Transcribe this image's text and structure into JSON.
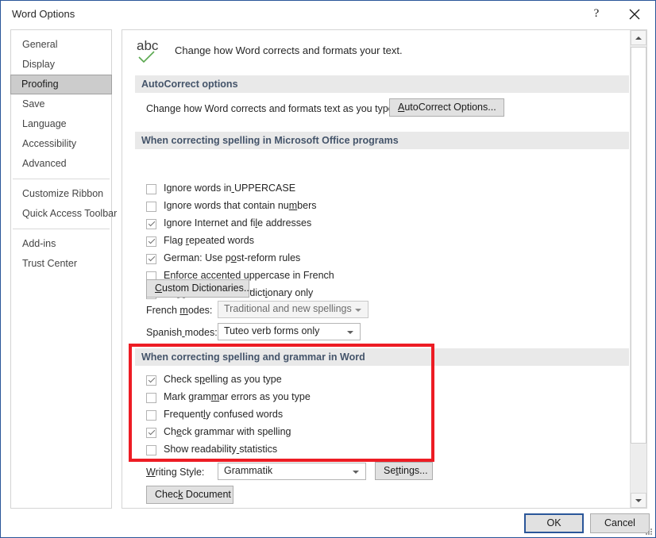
{
  "window": {
    "title": "Word Options",
    "help_glyph": "?",
    "close_icon": "close-icon"
  },
  "sidebar": {
    "items": [
      {
        "label": "General",
        "selected": false
      },
      {
        "label": "Display",
        "selected": false
      },
      {
        "label": "Proofing",
        "selected": true
      },
      {
        "label": "Save",
        "selected": false
      },
      {
        "label": "Language",
        "selected": false
      },
      {
        "label": "Accessibility",
        "selected": false
      },
      {
        "label": "Advanced",
        "selected": false
      },
      {
        "label": "Customize Ribbon",
        "selected": false
      },
      {
        "label": "Quick Access Toolbar",
        "selected": false
      },
      {
        "label": "Add-ins",
        "selected": false
      },
      {
        "label": "Trust Center",
        "selected": false
      }
    ]
  },
  "content": {
    "intro": {
      "icon": "abc-spellcheck-icon",
      "text": "Change how Word corrects and formats your text."
    },
    "autocorrect": {
      "header": "AutoCorrect options",
      "description": "Change how Word corrects and formats text as you type:",
      "button_label": "AutoCorrect Options...",
      "button_accesskey": "A"
    },
    "office_spelling": {
      "header": "When correcting spelling in Microsoft Office programs",
      "checkboxes": [
        {
          "label": "Ignore words in UPPERCASE",
          "checked": false,
          "accesskey": "U",
          "ak_index": 15
        },
        {
          "label": "Ignore words that contain numbers",
          "checked": false,
          "accesskey": "b",
          "ak_index": 28
        },
        {
          "label": "Ignore Internet and file addresses",
          "checked": true,
          "accesskey": "f",
          "ak_index": 22
        },
        {
          "label": "Flag repeated words",
          "checked": true,
          "accesskey": "r",
          "ak_index": 5
        },
        {
          "label": "German: Use post-reform rules",
          "checked": true,
          "accesskey": "o",
          "ak_index": 13
        },
        {
          "label": "Enforce accented uppercase in French",
          "checked": false,
          "accesskey": "e",
          "ak_index": 6
        },
        {
          "label": "Suggest from main dictionary only",
          "checked": false,
          "accesskey": "i",
          "ak_index": 22
        }
      ],
      "custom_dictionaries_label": "Custom Dictionaries...",
      "french_modes_label": "French modes:",
      "french_modes_value": "Traditional and new spellings",
      "french_modes_disabled": true,
      "spanish_modes_label": "Spanish modes:",
      "spanish_modes_value": "Tuteo verb forms only",
      "spanish_modes_disabled": false
    },
    "word_grammar": {
      "header": "When correcting spelling and grammar in Word",
      "highlighted": true,
      "highlight_color": "#ed1c24",
      "checkboxes": [
        {
          "label": "Check spelling as you type",
          "checked": true,
          "accesskey": "p",
          "ak_index": 7
        },
        {
          "label": "Mark grammar errors as you type",
          "checked": false,
          "accesskey": "m",
          "ak_index": 9
        },
        {
          "label": "Frequently confused words",
          "checked": false,
          "accesskey": "n",
          "ak_index": 8
        },
        {
          "label": "Check grammar with spelling",
          "checked": true,
          "accesskey": "h",
          "ak_index": 2
        },
        {
          "label": "Show readability statistics",
          "checked": false,
          "accesskey": "l",
          "ak_index": 16
        }
      ],
      "writing_style_label": "Writing Style:",
      "writing_style_value": "Grammatik",
      "settings_button": "Settings...",
      "check_document_button": "Check Document"
    }
  },
  "footer": {
    "ok_label": "OK",
    "cancel_label": "Cancel"
  },
  "scrollbar": {
    "orientation": "vertical",
    "up_icon": "chevron-up-icon",
    "down_icon": "chevron-down-icon"
  }
}
